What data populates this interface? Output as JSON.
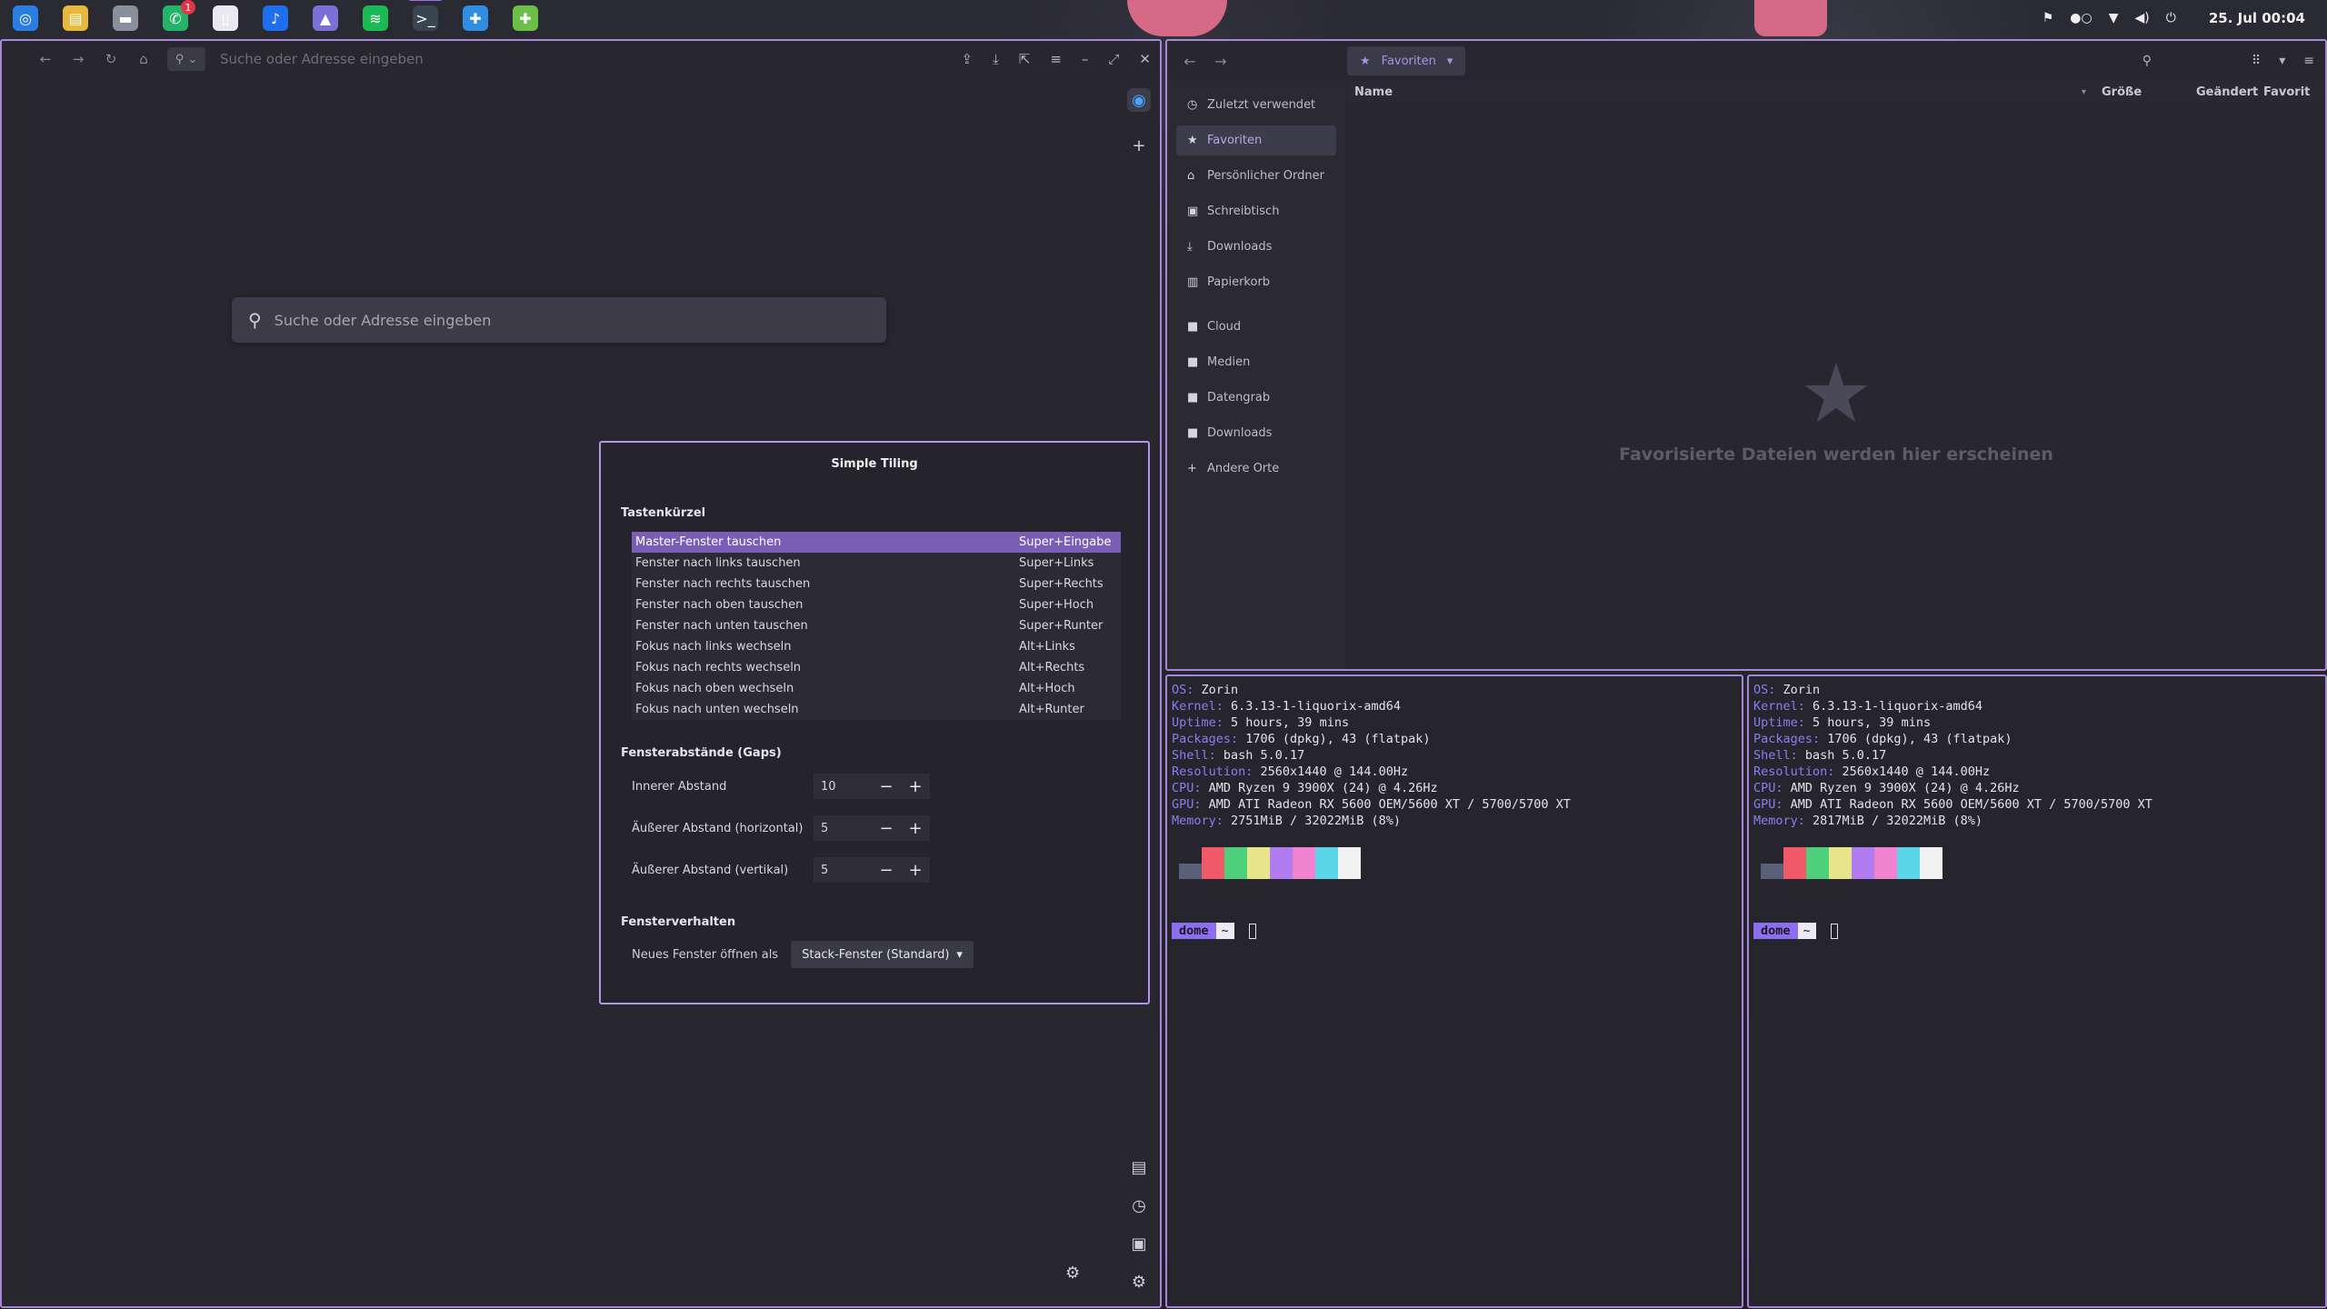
{
  "topbar": {
    "apps": [
      {
        "name": "browser-app-icon",
        "glyph": "◎",
        "color": "#2a7de1",
        "active": false,
        "badge": ""
      },
      {
        "name": "notes-app-icon",
        "glyph": "▤",
        "color": "#e8b83a",
        "active": false,
        "badge": ""
      },
      {
        "name": "files-app-icon",
        "glyph": "▬",
        "color": "#8a8f9c",
        "active": false,
        "badge": ""
      },
      {
        "name": "messenger-app-icon",
        "glyph": "✆",
        "color": "#25b36a",
        "active": false,
        "badge": "1"
      },
      {
        "name": "document-app-icon",
        "glyph": "▯",
        "color": "#e9e9ee",
        "active": false,
        "badge": ""
      },
      {
        "name": "music-app-icon",
        "glyph": "♪",
        "color": "#1e6ff0",
        "active": false,
        "badge": ""
      },
      {
        "name": "vpn-app-icon",
        "glyph": "▲",
        "color": "#7b6fd8",
        "active": false,
        "badge": ""
      },
      {
        "name": "spotify-app-icon",
        "glyph": "≋",
        "color": "#1db954",
        "active": false,
        "badge": ""
      },
      {
        "name": "terminal-app-icon",
        "glyph": ">_",
        "color": "#3a4552",
        "active": true,
        "badge": ""
      },
      {
        "name": "extensions-app-icon",
        "glyph": "✚",
        "color": "#2f8de4",
        "active": false,
        "badge": ""
      },
      {
        "name": "puzzle-app-icon",
        "glyph": "✚",
        "color": "#6cc04a",
        "active": false,
        "badge": ""
      }
    ],
    "clock": "25. Jul 00:04"
  },
  "browser": {
    "address_placeholder": "Suche oder Adresse eingeben",
    "big_search_placeholder": "Suche oder Adresse eingeben"
  },
  "dialog": {
    "title": "Simple Tiling",
    "shortcuts_heading": "Tastenkürzel",
    "shortcuts": [
      {
        "label": "Master-Fenster tauschen",
        "key": "Super+Eingabe"
      },
      {
        "label": "Fenster nach links tauschen",
        "key": "Super+Links"
      },
      {
        "label": "Fenster nach rechts tauschen",
        "key": "Super+Rechts"
      },
      {
        "label": "Fenster nach oben tauschen",
        "key": "Super+Hoch"
      },
      {
        "label": "Fenster nach unten tauschen",
        "key": "Super+Runter"
      },
      {
        "label": "Fokus nach links wechseln",
        "key": "Alt+Links"
      },
      {
        "label": "Fokus nach rechts wechseln",
        "key": "Alt+Rechts"
      },
      {
        "label": "Fokus nach oben wechseln",
        "key": "Alt+Hoch"
      },
      {
        "label": "Fokus nach unten wechseln",
        "key": "Alt+Runter"
      }
    ],
    "gaps_heading": "Fensterabstände (Gaps)",
    "inner_label": "Innerer Abstand",
    "inner_value": "10",
    "outer_h_label": "Äußerer Abstand (horizontal)",
    "outer_h_value": "5",
    "outer_v_label": "Äußerer Abstand (vertikal)",
    "outer_v_value": "5",
    "behavior_heading": "Fensterverhalten",
    "new_window_label": "Neues Fenster öffnen als",
    "new_window_value": "Stack-Fenster (Standard)"
  },
  "files": {
    "path_label": "Favoriten",
    "sidebar": [
      {
        "label": "Zuletzt verwendet",
        "icon": "◷",
        "name": "sidebar-item-recent"
      },
      {
        "label": "Favoriten",
        "icon": "★",
        "name": "sidebar-item-favorites",
        "selected": true
      },
      {
        "label": "Persönlicher Ordner",
        "icon": "⌂",
        "name": "sidebar-item-home"
      },
      {
        "label": "Schreibtisch",
        "icon": "▣",
        "name": "sidebar-item-desktop"
      },
      {
        "label": "Downloads",
        "icon": "⤓",
        "name": "sidebar-item-downloads"
      },
      {
        "label": "Papierkorb",
        "icon": "▥",
        "name": "sidebar-item-trash"
      }
    ],
    "sidebar2": [
      {
        "label": "Cloud",
        "icon": "■",
        "name": "sidebar-item-cloud"
      },
      {
        "label": "Medien",
        "icon": "■",
        "name": "sidebar-item-media"
      },
      {
        "label": "Datengrab",
        "icon": "■",
        "name": "sidebar-item-datengrab"
      },
      {
        "label": "Downloads",
        "icon": "■",
        "name": "sidebar-item-downloads-2"
      }
    ],
    "other_places": "Andere Orte",
    "columns": {
      "name": "Name",
      "size": "Größe",
      "modified": "Geändert",
      "favorite": "Favorit"
    },
    "empty_text": "Favorisierte Dateien werden hier erscheinen"
  },
  "term1": {
    "lines": [
      {
        "k": "OS:",
        "v": " Zorin"
      },
      {
        "k": "Kernel:",
        "v": " 6.3.13-1-liquorix-amd64"
      },
      {
        "k": "Uptime:",
        "v": " 5 hours, 39 mins"
      },
      {
        "k": "Packages:",
        "v": " 1706 (dpkg), 43 (flatpak)"
      },
      {
        "k": "Shell:",
        "v": " bash 5.0.17"
      },
      {
        "k": "Resolution:",
        "v": " 2560x1440 @ 144.00Hz"
      },
      {
        "k": "CPU:",
        "v": " AMD Ryzen 9 3900X (24) @ 4.26Hz"
      },
      {
        "k": "GPU:",
        "v": " AMD ATI Radeon RX 5600 OEM/5600 XT / 5700/5700 XT"
      },
      {
        "k": "Memory:",
        "v": " 2751MiB / 32022MiB (8%)"
      }
    ],
    "user": "dome",
    "dir": "~"
  },
  "term2": {
    "lines": [
      {
        "k": "OS:",
        "v": " Zorin"
      },
      {
        "k": "Kernel:",
        "v": " 6.3.13-1-liquorix-amd64"
      },
      {
        "k": "Uptime:",
        "v": " 5 hours, 39 mins"
      },
      {
        "k": "Packages:",
        "v": " 1706 (dpkg), 43 (flatpak)"
      },
      {
        "k": "Shell:",
        "v": " bash 5.0.17"
      },
      {
        "k": "Resolution:",
        "v": " 2560x1440 @ 144.00Hz"
      },
      {
        "k": "CPU:",
        "v": " AMD Ryzen 9 3900X (24) @ 4.26Hz"
      },
      {
        "k": "GPU:",
        "v": " AMD ATI Radeon RX 5600 OEM/5600 XT / 5700/5700 XT"
      },
      {
        "k": "Memory:",
        "v": " 2817MiB / 32022MiB (8%)"
      }
    ],
    "user": "dome",
    "dir": "~"
  },
  "palette": [
    "#5a6078",
    "#f05a68",
    "#4ed07a",
    "#e8e48a",
    "#b07cf0",
    "#f082d0",
    "#5ad6e8",
    "#f2f2f2"
  ],
  "colors": {
    "accent": "#a888d6",
    "selection": "#7a5db5",
    "prompt": "#8d6ef2",
    "key_label": "#8d7df0"
  }
}
